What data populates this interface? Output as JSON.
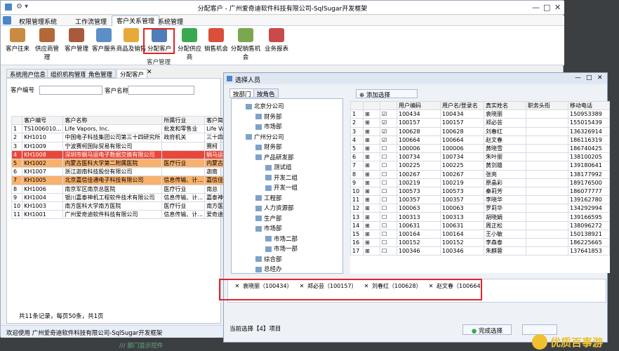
{
  "window": {
    "title": "分配客户 - 广州爱奇迪软件科技有限公司-SqlSugar开发框架",
    "min": "—",
    "max": "□",
    "close": "✕"
  },
  "menu": [
    "权限管理系统",
    "工作流管理",
    "客户关系管理",
    "系统管理"
  ],
  "ribbon": {
    "buttons": [
      "客户往来",
      "供应商管理",
      "客户管理",
      "客户服务",
      "商品及销售",
      "分配客户",
      "分配供应商",
      "销售机会",
      "分配销售机会",
      "业务报表"
    ],
    "group": "客户管理"
  },
  "doctabs": [
    "系统用户信息",
    "组织机构管理",
    "角色管理",
    "分配客户"
  ],
  "search": {
    "code_label": "客户编号",
    "name_label": "客户名称"
  },
  "customers": {
    "headers": [
      "客户编号",
      "客户名称",
      "所属行业",
      "客户简称"
    ],
    "rows": [
      [
        "TS1006010...",
        "Life Vapors, Inc.",
        "批发和零售业",
        "Life Vap"
      ],
      [
        "KH1010",
        "中国电子科技集团公司第三十四研究所",
        "政府机关",
        "三十四研"
      ],
      [
        "KH1009",
        "宁波赛柯国际贸易有限公司",
        "",
        "赛柯"
      ],
      [
        "KH1008",
        "深圳市蜗马运电子数据交换有限公司",
        "",
        "蜗马运"
      ],
      [
        "KH1002",
        "内蒙古医科大学第二附属医院",
        "医疗行业",
        "内蒙古"
      ],
      [
        "KH1007",
        "浙江迦南科技股份有限公司",
        "",
        "迦南"
      ],
      [
        "KH1005",
        "北京嘉信佳通电子科技有限公司",
        "信息传输、计...",
        "嘉信佳通"
      ],
      [
        "KH1006",
        "南京军区南京总医院",
        "医疗行业",
        "南总"
      ],
      [
        "KH1004",
        "银川嘉泰神机工程软件技术有限公司",
        "信息传输、计...",
        "嘉泰神机"
      ],
      [
        "KH1003",
        "南方医科大学南方医院",
        "医疗行业",
        "南方医院"
      ],
      [
        "KH1001",
        "广州爱奇迪软件科技有限公司",
        "信息传输、计...",
        "爱奇迪"
      ]
    ],
    "row_nums": [
      "1",
      "2",
      "3",
      "4",
      "5",
      "6",
      "7",
      "8",
      "9",
      "10",
      "11"
    ]
  },
  "pager": "共11条记录，每页50条，共1页",
  "statusbar": "欢迎使用 广州爱奇迪软件科技有限公司-SqlSugar开发框架",
  "code_comment": "/// 部门显示控件",
  "dialog": {
    "title": "选择人员",
    "tabs": [
      "按部门",
      "按角色"
    ],
    "add_button": "添加选择",
    "tree": [
      {
        "label": "北京分公司",
        "level": 0
      },
      {
        "label": "财务部",
        "level": 1
      },
      {
        "label": "市场部",
        "level": 1
      },
      {
        "label": "广州分公司",
        "level": 0
      },
      {
        "label": "财务部",
        "level": 1
      },
      {
        "label": "产品研发部",
        "level": 1
      },
      {
        "label": "测试组",
        "level": 2
      },
      {
        "label": "开发二组",
        "level": 2
      },
      {
        "label": "开发一组",
        "level": 2
      },
      {
        "label": "工程部",
        "level": 1
      },
      {
        "label": "人力资源部",
        "level": 1
      },
      {
        "label": "生产部",
        "level": 1
      },
      {
        "label": "市场部",
        "level": 1
      },
      {
        "label": "市场二部",
        "level": 2
      },
      {
        "label": "市场一部",
        "level": 2
      },
      {
        "label": "综合部",
        "level": 1
      },
      {
        "label": "总经办",
        "level": 1
      }
    ],
    "users": {
      "headers": [
        "用户编码",
        "用户名/登录名",
        "真实姓名",
        "职务头衔",
        "移动电话"
      ],
      "rows": [
        [
          "100434",
          "100434",
          "袁晓丽",
          "",
          "150953389"
        ],
        [
          "100157",
          "100157",
          "郑必芸",
          "",
          "155015439"
        ],
        [
          "100628",
          "100628",
          "刘春红",
          "",
          "136326914"
        ],
        [
          "100664",
          "100664",
          "赵文春",
          "",
          "186116319"
        ],
        [
          "100006",
          "100006",
          "黄晓雪",
          "",
          "186740425"
        ],
        [
          "100734",
          "100734",
          "朱叶丽",
          "",
          "138100205"
        ],
        [
          "100225",
          "100225",
          "黄剑雄",
          "",
          "139180641"
        ],
        [
          "100267",
          "100267",
          "张亮",
          "",
          "138177992"
        ],
        [
          "100219",
          "100219",
          "原晶彩",
          "",
          "189176500"
        ],
        [
          "100573",
          "100573",
          "秦莉芳",
          "",
          "186077777"
        ],
        [
          "100357",
          "100357",
          "李晓华",
          "",
          "139162780"
        ],
        [
          "100063",
          "100063",
          "罗莉华",
          "",
          "134292994"
        ],
        [
          "100313",
          "100313",
          "胡晓娟",
          "",
          "139166595"
        ],
        [
          "100631",
          "100631",
          "周正松",
          "",
          "138096272"
        ],
        [
          "100164",
          "100164",
          "王小敏",
          "",
          "150138921"
        ],
        [
          "100152",
          "100152",
          "李森泰",
          "",
          "186225665"
        ],
        [
          "100346",
          "100346",
          "朱麒蓉",
          "",
          "137641853"
        ]
      ],
      "checked": [
        true,
        true,
        true,
        true,
        false,
        false,
        false,
        false,
        false,
        false,
        false,
        false,
        false,
        false,
        false,
        false,
        false
      ],
      "row_nums": [
        "1",
        "2",
        "3",
        "4",
        "5",
        "6",
        "7",
        "8",
        "9",
        "10",
        "11",
        "12",
        "13",
        "14",
        "15",
        "16",
        "17"
      ]
    },
    "selected": [
      "袁晓丽（100434）",
      "郑必芸（100157）",
      "刘春红（100628）",
      "赵文春（100664）"
    ],
    "status": "当前选择【4】项目",
    "finish": "完成选择"
  },
  "watermark": "优质百事游",
  "colors": {
    "highlight": "#e0242a",
    "accent": "#4a86c8",
    "orange": "#f7b26e",
    "red_row": "#e8483c"
  }
}
